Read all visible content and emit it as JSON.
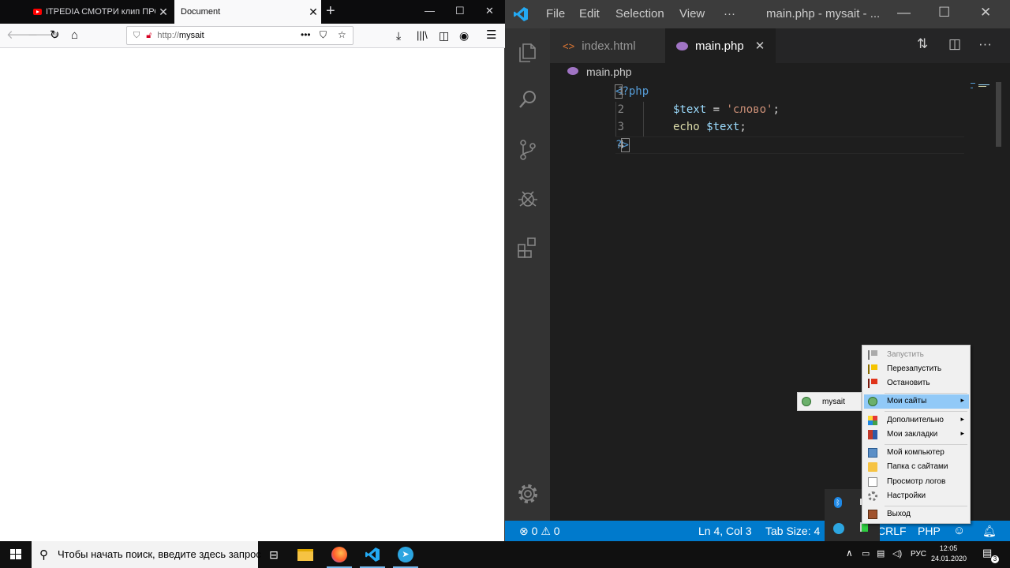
{
  "firefox": {
    "tabs": [
      {
        "title": "ITPEDIA СМОТРИ клип ПРО С",
        "close": "✕"
      },
      {
        "title": "Document",
        "close": "✕"
      }
    ],
    "new_tab": "+",
    "window_controls": {
      "minimize": "—",
      "maximize": "☐",
      "close": "✕"
    },
    "url": {
      "protocol": "http://",
      "host": "mysait"
    },
    "icons": [
      "back-arrow-icon",
      "forward-arrow-icon",
      "reload-icon",
      "home-icon",
      "shield-icon",
      "insecure-lock-icon",
      "more-dots-icon",
      "pocket-icon",
      "bookmark-star-icon",
      "download-icon",
      "library-icon",
      "sidebar-icon",
      "account-icon",
      "hamburger-menu-icon"
    ]
  },
  "vscode": {
    "menu": [
      "File",
      "Edit",
      "Selection",
      "View",
      "···"
    ],
    "window_title": "main.php - mysait - ...",
    "window_controls": {
      "minimize": "—",
      "maximize": "☐",
      "close": "✕"
    },
    "tabs": [
      {
        "label": "index.html",
        "icon": "<>",
        "active": false
      },
      {
        "label": "main.php",
        "icon": "php-elephant-icon",
        "active": true,
        "close": "✕"
      }
    ],
    "breadcrumb": "main.php",
    "editor": {
      "line_numbers": [
        "1",
        "2",
        "3",
        "4"
      ],
      "lines": {
        "l1_open": "<",
        "l1_rest": "?php",
        "l2_var": "$text",
        "l2_eq": " = ",
        "l2_str": "'слово'",
        "l2_semi": ";",
        "l3_echo": "echo",
        "l3_sp": " ",
        "l3_var": "$text",
        "l3_semi": ";",
        "l4_q": "?",
        "l4_close": ">"
      }
    },
    "status": {
      "errors": "0",
      "warnings": "0",
      "position": "Ln 4, Col 3",
      "tab_size": "Tab Size: 4",
      "eol": "CRLF",
      "language": "PHP"
    },
    "accent": "#007acc"
  },
  "tray_menu": {
    "items": [
      {
        "label": "Запустить",
        "disabled": true,
        "icon": "grey-flag-icon"
      },
      {
        "label": "Перезапустить",
        "icon": "yellow-flag-icon"
      },
      {
        "label": "Остановить",
        "icon": "red-flag-icon"
      },
      {
        "label": "Мои сайты",
        "highlighted": true,
        "submenu": true,
        "icon": "globe-icon"
      },
      {
        "label": "Дополнительно",
        "submenu": true,
        "icon": "shapes-icon"
      },
      {
        "label": "Мои закладки",
        "submenu": true,
        "icon": "bookmarks-icon"
      },
      {
        "label": "Мой компьютер",
        "icon": "computer-icon"
      },
      {
        "label": "Папка с сайтами",
        "icon": "folder-icon"
      },
      {
        "label": "Просмотр логов",
        "icon": "log-icon"
      },
      {
        "label": "Настройки",
        "icon": "gear-icon"
      },
      {
        "label": "Выход",
        "icon": "exit-door-icon"
      }
    ],
    "submenu_item": "mysait"
  },
  "taskbar": {
    "search_placeholder": "Чтобы начать поиск, введите здесь запрос",
    "lang": "РУС",
    "time": "12:05",
    "date": "24.01.2020",
    "notification_count": "3"
  }
}
